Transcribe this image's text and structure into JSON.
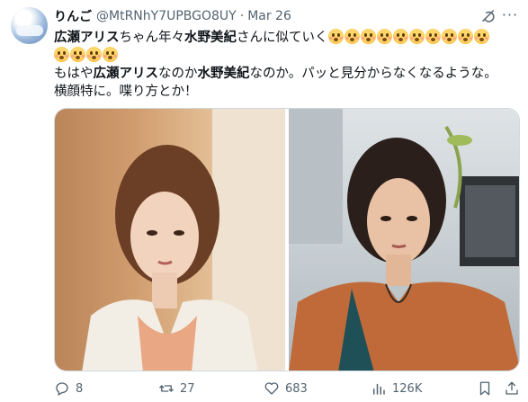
{
  "tweet": {
    "author": {
      "name": "りんご",
      "handle": "@MtRNhY7UPBGO8UY",
      "separator": "·",
      "date": "Mar 26"
    },
    "text": {
      "line1": {
        "a": "広瀬アリス",
        "b": "ちゃん年々",
        "c": "水野美紀",
        "d": "さんに似ていく"
      },
      "line3": {
        "a": "もはや",
        "b": "広瀬アリス",
        "c": "なのか",
        "d": "水野美紀",
        "e": "なのか。パッと見分からなくなるような。"
      },
      "line4": "横顔特に。喋り方とか！",
      "emoji_name": "flushed-face-emoji",
      "emoji_count_line1": 10,
      "emoji_count_line2": 4
    },
    "stats": {
      "replies": "8",
      "retweets": "27",
      "likes": "683",
      "views": "126K"
    },
    "colors": {
      "text": "#0f1419",
      "muted": "#536471",
      "border": "#cfd9de"
    }
  }
}
